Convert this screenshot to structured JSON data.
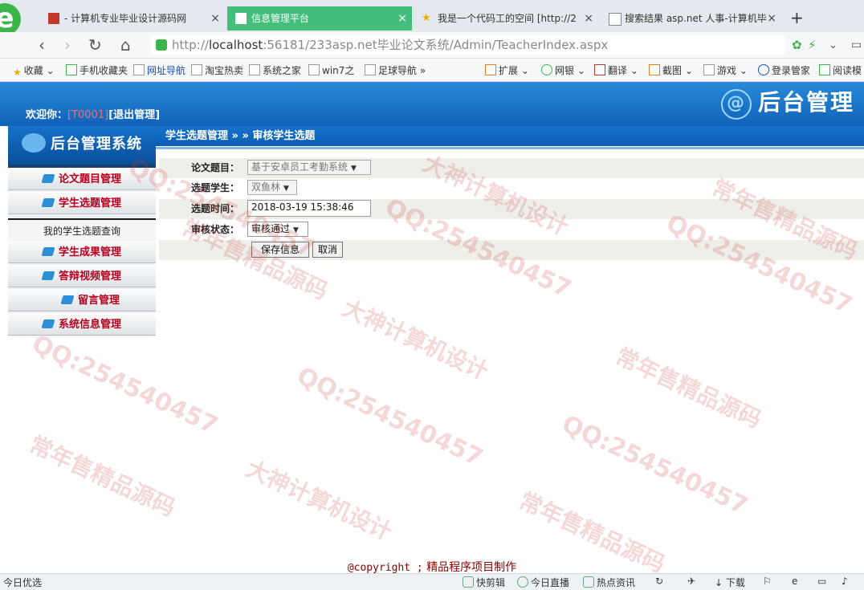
{
  "browser": {
    "tabs": [
      {
        "label": "- 计算机专业毕业设计源码网",
        "active": false
      },
      {
        "label": "信息管理平台",
        "active": true
      },
      {
        "label": "我是一个代码工的空间 [http://2",
        "active": false
      },
      {
        "label": "搜索结果 asp.net 人事-计算机毕",
        "active": false
      }
    ],
    "close_glyph": "×",
    "new_tab_glyph": "+",
    "address": {
      "scheme": "http://",
      "host": "localhost",
      "rest": ":56181/233asp.net毕业论文系统/Admin/TeacherIndex.aspx"
    },
    "bookmarks": [
      {
        "label": "收藏",
        "kind": "fav"
      },
      {
        "label": "手机收藏夹"
      },
      {
        "label": "网址导航"
      },
      {
        "label": "淘宝热卖"
      },
      {
        "label": "系统之家"
      },
      {
        "label": "win7之"
      },
      {
        "label": "足球导航"
      },
      {
        "label": "扩展"
      },
      {
        "label": "网银"
      },
      {
        "label": "翻译"
      },
      {
        "label": "截图"
      },
      {
        "label": "游戏"
      },
      {
        "label": "登录管家"
      },
      {
        "label": "阅读模"
      }
    ],
    "status": [
      {
        "label": "今日优选"
      },
      {
        "label": "快剪辑"
      },
      {
        "label": "今日直播"
      },
      {
        "label": "热点资讯"
      },
      {
        "label": "下载"
      }
    ]
  },
  "header": {
    "banner_title": "后台管理",
    "welcome_prefix": "欢迎你：",
    "user_id": "[T0001]",
    "logout": "[退出管理]"
  },
  "breadcrumb": "学生选题管理 » » 审核学生选题",
  "sidebar": {
    "title": "后台管理系统",
    "items": [
      {
        "label": "论文题目管理"
      },
      {
        "label": "学生选题管理"
      },
      {
        "label": "我的学生选题查询",
        "sub": true
      },
      {
        "label": "学生成果管理"
      },
      {
        "label": "答辩视频管理"
      },
      {
        "label": "留言管理"
      },
      {
        "label": "系统信息管理"
      }
    ]
  },
  "form": {
    "topic_label": "论文题目：",
    "topic_value": "基于安卓员工考勤系统",
    "student_label": "选题学生：",
    "student_value": "双鱼林",
    "time_label": "选题时间：",
    "time_value": "2018-03-19 15:38:46",
    "status_label": "审核状态：",
    "status_value": "审核通过",
    "save_label": "保存信息",
    "cancel_label": "取消"
  },
  "footer": {
    "copyright": "@copyright ;",
    "maker": "精品程序项目制作"
  },
  "watermarks": [
    "QQ:254540457",
    "大神计算机设计",
    "常年售精品源码"
  ]
}
